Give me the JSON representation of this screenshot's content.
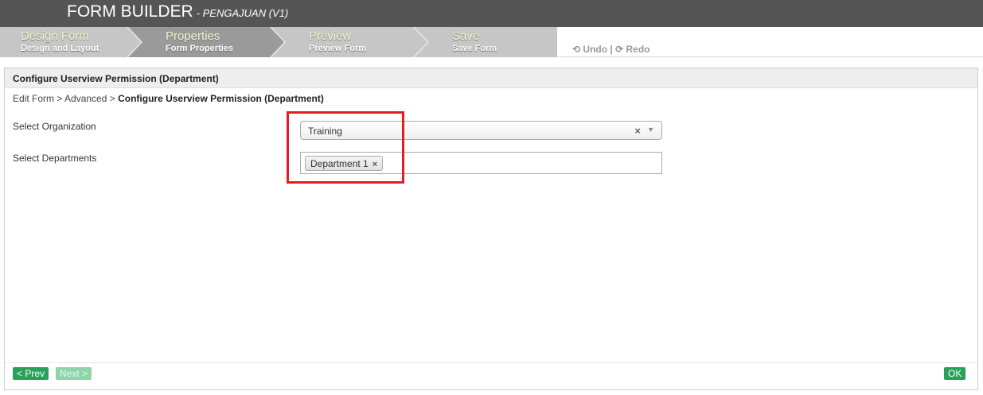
{
  "header": {
    "title": "FORM BUILDER",
    "subtitle": "- PENGAJUAN (V1)"
  },
  "steps": [
    {
      "label": "Design Form",
      "sublabel": "Design and Layout"
    },
    {
      "label": "Properties",
      "sublabel": "Form Properties"
    },
    {
      "label": "Preview",
      "sublabel": "Preview Form"
    },
    {
      "label": "Save",
      "sublabel": "Save Form"
    }
  ],
  "toolbar": {
    "undo_icon": "undo-icon",
    "undo_label": "Undo",
    "separator": "|",
    "redo_icon": "redo-icon",
    "redo_label": "Redo"
  },
  "panel": {
    "title": "Configure Userview Permission (Department)",
    "breadcrumb": {
      "part1": "Edit Form",
      "sep1": " > ",
      "part2": "Advanced",
      "sep2": " > ",
      "current": "Configure Userview Permission (Department)"
    },
    "fields": {
      "organization_label": "Select Organization",
      "organization_value": "Training",
      "clear_glyph": "×",
      "arrow_glyph": "▼",
      "departments_label": "Select Departments",
      "departments_selected": [
        "Department 1"
      ],
      "chip_remove_glyph": "×"
    }
  },
  "footer": {
    "prev_label": "< Prev",
    "next_label": "Next >",
    "ok_label": "OK"
  },
  "colors": {
    "topbar": "#555555",
    "accent_green": "#2aa05a",
    "highlight_red": "#e11d25"
  }
}
